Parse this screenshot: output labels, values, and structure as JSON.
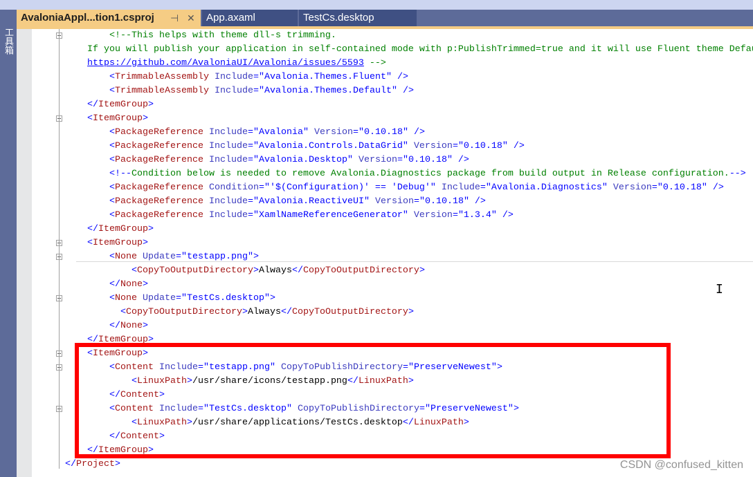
{
  "sidebar": {
    "label": "工具箱"
  },
  "tabs": [
    {
      "label": "AvaloniaAppl...tion1.csproj",
      "active": true,
      "pin": "⊣",
      "close": "✕"
    },
    {
      "label": "App.axaml"
    },
    {
      "label": "TestCs.desktop"
    }
  ],
  "code_lines": [
    {
      "indent": 8,
      "tokens": [
        [
          "c",
          "<!--This helps with theme dll-s trimming."
        ]
      ]
    },
    {
      "indent": 4,
      "tokens": [
        [
          "c",
          "If you will publish your application in self-contained mode with p:PublishTrimmed=true and it will use Fluent theme Default"
        ]
      ]
    },
    {
      "indent": 4,
      "tokens": [
        [
          "l",
          "https://github.com/AvaloniaUI/Avalonia/issues/5593"
        ],
        [
          "c",
          " -->"
        ]
      ]
    },
    {
      "indent": 8,
      "tokens": [
        [
          "b",
          "<"
        ],
        [
          "e",
          "TrimmableAssembly"
        ],
        [
          "a",
          " Include"
        ],
        [
          "b",
          "="
        ],
        [
          "v",
          "\"Avalonia.Themes.Fluent\""
        ],
        [
          "b",
          " />"
        ]
      ]
    },
    {
      "indent": 8,
      "tokens": [
        [
          "b",
          "<"
        ],
        [
          "e",
          "TrimmableAssembly"
        ],
        [
          "a",
          " Include"
        ],
        [
          "b",
          "="
        ],
        [
          "v",
          "\"Avalonia.Themes.Default\""
        ],
        [
          "b",
          " />"
        ]
      ]
    },
    {
      "indent": 4,
      "tokens": [
        [
          "b",
          "</"
        ],
        [
          "e",
          "ItemGroup"
        ],
        [
          "b",
          ">"
        ]
      ]
    },
    {
      "indent": 4,
      "tokens": [
        [
          "b",
          "<"
        ],
        [
          "e",
          "ItemGroup"
        ],
        [
          "b",
          ">"
        ]
      ]
    },
    {
      "indent": 8,
      "tokens": [
        [
          "b",
          "<"
        ],
        [
          "e",
          "PackageReference"
        ],
        [
          "a",
          " Include"
        ],
        [
          "b",
          "="
        ],
        [
          "v",
          "\"Avalonia\""
        ],
        [
          "a",
          " Version"
        ],
        [
          "b",
          "="
        ],
        [
          "v",
          "\"0.10.18\""
        ],
        [
          "b",
          " />"
        ]
      ]
    },
    {
      "indent": 8,
      "tokens": [
        [
          "b",
          "<"
        ],
        [
          "e",
          "PackageReference"
        ],
        [
          "a",
          " Include"
        ],
        [
          "b",
          "="
        ],
        [
          "v",
          "\"Avalonia.Controls.DataGrid\""
        ],
        [
          "a",
          " Version"
        ],
        [
          "b",
          "="
        ],
        [
          "v",
          "\"0.10.18\""
        ],
        [
          "b",
          " />"
        ]
      ]
    },
    {
      "indent": 8,
      "tokens": [
        [
          "b",
          "<"
        ],
        [
          "e",
          "PackageReference"
        ],
        [
          "a",
          " Include"
        ],
        [
          "b",
          "="
        ],
        [
          "v",
          "\"Avalonia.Desktop\""
        ],
        [
          "a",
          " Version"
        ],
        [
          "b",
          "="
        ],
        [
          "v",
          "\"0.10.18\""
        ],
        [
          "b",
          " />"
        ]
      ]
    },
    {
      "indent": 8,
      "tokens": [
        [
          "b",
          "<!--"
        ],
        [
          "c",
          "Condition below is needed to remove Avalonia.Diagnostics package from build output in Release configuration."
        ],
        [
          "b",
          "-->"
        ]
      ]
    },
    {
      "indent": 8,
      "tokens": [
        [
          "b",
          "<"
        ],
        [
          "e",
          "PackageReference"
        ],
        [
          "a",
          " Condition"
        ],
        [
          "b",
          "="
        ],
        [
          "v",
          "\"'$(Configuration)' == 'Debug'\""
        ],
        [
          "a",
          " Include"
        ],
        [
          "b",
          "="
        ],
        [
          "v",
          "\"Avalonia.Diagnostics\""
        ],
        [
          "a",
          " Version"
        ],
        [
          "b",
          "="
        ],
        [
          "v",
          "\"0.10.18\""
        ],
        [
          "b",
          " />"
        ]
      ]
    },
    {
      "indent": 8,
      "tokens": [
        [
          "b",
          "<"
        ],
        [
          "e",
          "PackageReference"
        ],
        [
          "a",
          " Include"
        ],
        [
          "b",
          "="
        ],
        [
          "v",
          "\"Avalonia.ReactiveUI\""
        ],
        [
          "a",
          " Version"
        ],
        [
          "b",
          "="
        ],
        [
          "v",
          "\"0.10.18\""
        ],
        [
          "b",
          " />"
        ]
      ]
    },
    {
      "indent": 8,
      "tokens": [
        [
          "b",
          "<"
        ],
        [
          "e",
          "PackageReference"
        ],
        [
          "a",
          " Include"
        ],
        [
          "b",
          "="
        ],
        [
          "v",
          "\"XamlNameReferenceGenerator\""
        ],
        [
          "a",
          " Version"
        ],
        [
          "b",
          "="
        ],
        [
          "v",
          "\"1.3.4\""
        ],
        [
          "b",
          " />"
        ]
      ]
    },
    {
      "indent": 4,
      "tokens": [
        [
          "b",
          "</"
        ],
        [
          "e",
          "ItemGroup"
        ],
        [
          "b",
          ">"
        ]
      ]
    },
    {
      "indent": 4,
      "tokens": [
        [
          "b",
          "<"
        ],
        [
          "e",
          "ItemGroup"
        ],
        [
          "b",
          ">"
        ]
      ]
    },
    {
      "indent": 8,
      "tokens": [
        [
          "b",
          "<"
        ],
        [
          "e",
          "None"
        ],
        [
          "a",
          " Update"
        ],
        [
          "b",
          "="
        ],
        [
          "v",
          "\"testapp.png\""
        ],
        [
          "b",
          ">"
        ]
      ]
    },
    {
      "indent": 12,
      "tokens": [
        [
          "b",
          "<"
        ],
        [
          "e",
          "CopyToOutputDirectory"
        ],
        [
          "b",
          ">"
        ],
        [
          "t",
          "Always"
        ],
        [
          "b",
          "</"
        ],
        [
          "e",
          "CopyToOutputDirectory"
        ],
        [
          "b",
          ">"
        ]
      ]
    },
    {
      "indent": 8,
      "tokens": [
        [
          "b",
          "</"
        ],
        [
          "e",
          "None"
        ],
        [
          "b",
          ">"
        ]
      ]
    },
    {
      "indent": 8,
      "tokens": [
        [
          "b",
          "<"
        ],
        [
          "e",
          "None"
        ],
        [
          "a",
          " Update"
        ],
        [
          "b",
          "="
        ],
        [
          "v",
          "\"TestCs.desktop\""
        ],
        [
          "b",
          ">"
        ]
      ]
    },
    {
      "indent": 10,
      "tokens": [
        [
          "b",
          "<"
        ],
        [
          "e",
          "CopyToOutputDirectory"
        ],
        [
          "b",
          ">"
        ],
        [
          "t",
          "Always"
        ],
        [
          "b",
          "</"
        ],
        [
          "e",
          "CopyToOutputDirectory"
        ],
        [
          "b",
          ">"
        ]
      ]
    },
    {
      "indent": 8,
      "tokens": [
        [
          "b",
          "</"
        ],
        [
          "e",
          "None"
        ],
        [
          "b",
          ">"
        ]
      ]
    },
    {
      "indent": 4,
      "tokens": [
        [
          "b",
          "</"
        ],
        [
          "e",
          "ItemGroup"
        ],
        [
          "b",
          ">"
        ]
      ]
    },
    {
      "indent": 4,
      "tokens": [
        [
          "b",
          "<"
        ],
        [
          "e",
          "ItemGroup"
        ],
        [
          "b",
          ">"
        ]
      ]
    },
    {
      "indent": 8,
      "tokens": [
        [
          "b",
          "<"
        ],
        [
          "e",
          "Content"
        ],
        [
          "a",
          " Include"
        ],
        [
          "b",
          "="
        ],
        [
          "v",
          "\"testapp.png\""
        ],
        [
          "a",
          " CopyToPublishDirectory"
        ],
        [
          "b",
          "="
        ],
        [
          "v",
          "\"PreserveNewest\""
        ],
        [
          "b",
          ">"
        ]
      ]
    },
    {
      "indent": 12,
      "tokens": [
        [
          "b",
          "<"
        ],
        [
          "e",
          "LinuxPath"
        ],
        [
          "b",
          ">"
        ],
        [
          "t",
          "/usr/share/icons/testapp.png"
        ],
        [
          "b",
          "</"
        ],
        [
          "e",
          "LinuxPath"
        ],
        [
          "b",
          ">"
        ]
      ]
    },
    {
      "indent": 8,
      "tokens": [
        [
          "b",
          "</"
        ],
        [
          "e",
          "Content"
        ],
        [
          "b",
          ">"
        ]
      ]
    },
    {
      "indent": 8,
      "tokens": [
        [
          "b",
          "<"
        ],
        [
          "e",
          "Content"
        ],
        [
          "a",
          " Include"
        ],
        [
          "b",
          "="
        ],
        [
          "v",
          "\"TestCs.desktop\""
        ],
        [
          "a",
          " CopyToPublishDirectory"
        ],
        [
          "b",
          "="
        ],
        [
          "v",
          "\"PreserveNewest\""
        ],
        [
          "b",
          ">"
        ]
      ]
    },
    {
      "indent": 12,
      "tokens": [
        [
          "b",
          "<"
        ],
        [
          "e",
          "LinuxPath"
        ],
        [
          "b",
          ">"
        ],
        [
          "t",
          "/usr/share/applications/TestCs.desktop"
        ],
        [
          "b",
          "</"
        ],
        [
          "e",
          "LinuxPath"
        ],
        [
          "b",
          ">"
        ]
      ]
    },
    {
      "indent": 8,
      "tokens": [
        [
          "b",
          "</"
        ],
        [
          "e",
          "Content"
        ],
        [
          "b",
          ">"
        ]
      ]
    },
    {
      "indent": 4,
      "tokens": [
        [
          "b",
          "</"
        ],
        [
          "e",
          "ItemGroup"
        ],
        [
          "b",
          ">"
        ]
      ]
    },
    {
      "indent": 0,
      "tokens": [
        [
          "b",
          "</"
        ],
        [
          "e",
          "Project"
        ],
        [
          "b",
          ">"
        ]
      ]
    }
  ],
  "folded_lines": [
    0,
    6,
    15,
    16,
    19,
    23,
    24,
    27
  ],
  "watermark": "CSDN @confused_kitten"
}
